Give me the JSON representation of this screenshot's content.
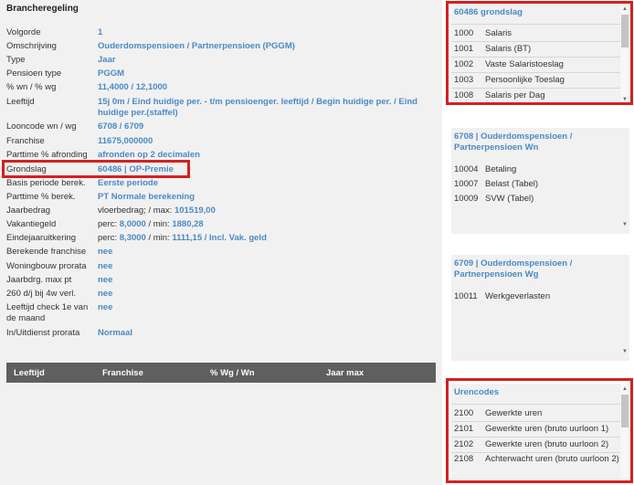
{
  "panel": {
    "title": "Brancheregeling",
    "fields": [
      {
        "label": "Volgorde",
        "value": "1"
      },
      {
        "label": "Omschrijving",
        "value": "Ouderdomspensioen / Partnerpensioen (PGGM)"
      },
      {
        "label": "Type",
        "value": "Jaar"
      },
      {
        "label": "Pensioen type",
        "value": "PGGM"
      },
      {
        "label": "% wn / % wg",
        "value": "11,4000 / 12,1000"
      },
      {
        "label": "Leeftijd",
        "value": "15j 0m / Eind huidige per. - t/m pensioenger. leeftijd / Begin huidige per. / Eind huidige per.(staffel)"
      },
      {
        "label": "Looncode wn / wg",
        "value": "6708 / 6709"
      },
      {
        "label": "Franchise",
        "value": "11675,000000"
      },
      {
        "label": "Parttime % afronding",
        "value": "afronden op 2 decimalen"
      },
      {
        "label": "Grondslag",
        "value": "60486 | OP-Premie"
      },
      {
        "label": "Basis periode berek.",
        "value": "Eerste periode"
      },
      {
        "label": "Parttime % berek.",
        "value": "PT Normale berekening"
      },
      {
        "label": "Jaarbedrag",
        "value_prefix": "vloerbedrag; / max: ",
        "value_link": "101519,00"
      },
      {
        "label": "Vakantiegeld",
        "value_prefix": "perc: ",
        "value_link": "8,0000",
        "value_mid": " / min: ",
        "value_link2": "1880,28"
      },
      {
        "label": "Eindejaaruitkering",
        "value_prefix": "perc: ",
        "value_link": "8,3000",
        "value_mid": " / min: ",
        "value_link2": "1111,15",
        "value_suffix": " / Incl. Vak. geld"
      },
      {
        "label": "Berekende franchise",
        "value": "nee"
      },
      {
        "label": "Woningbouw prorata",
        "value": "nee"
      },
      {
        "label": "Jaarbdrg. max pt",
        "value": "nee"
      },
      {
        "label": "260 d/j bij 4w verl.",
        "value": "nee"
      },
      {
        "label": "Leeftijd check 1e van de maand",
        "value": "nee"
      },
      {
        "label": "In/Uitdienst prorata",
        "value": "Normaal"
      }
    ],
    "table_headers": [
      "Leeftijd",
      "Franchise",
      "% Wg / Wn",
      "Jaar max"
    ]
  },
  "grondslag_panel": {
    "title": "60486 grondslag",
    "items": [
      {
        "code": "1000",
        "desc": "Salaris"
      },
      {
        "code": "1001",
        "desc": "Salaris (BT)"
      },
      {
        "code": "1002",
        "desc": "Vaste Salaristoeslag"
      },
      {
        "code": "1003",
        "desc": "Persoonlijke Toeslag"
      },
      {
        "code": "1008",
        "desc": "Salaris per Dag"
      }
    ]
  },
  "wn_panel": {
    "title": "6708 | Ouderdomspensioen / Partnerpensioen Wn",
    "items": [
      {
        "code": "10004",
        "desc": "Betaling"
      },
      {
        "code": "10007",
        "desc": "Belast (Tabel)"
      },
      {
        "code": "10009",
        "desc": "SVW (Tabel)"
      }
    ]
  },
  "wg_panel": {
    "title": "6709 | Ouderdomspensioen / Partnerpensioen Wg",
    "items": [
      {
        "code": "10011",
        "desc": "Werkgeverlasten"
      }
    ]
  },
  "urencodes_panel": {
    "title": "Urencodes",
    "items": [
      {
        "code": "2100",
        "desc": "Gewerkte uren"
      },
      {
        "code": "2101",
        "desc": "Gewerkte uren (bruto uurloon 1)"
      },
      {
        "code": "2102",
        "desc": "Gewerkte uren (bruto uurloon 2)"
      },
      {
        "code": "2108",
        "desc": "Achterwacht uren (bruto uurloon 2)"
      }
    ]
  },
  "colors": {
    "link": "#4a8ac6",
    "highlight": "#d42020",
    "header_bg": "#5f5f5f",
    "panel_bg": "#f1f1f1"
  }
}
